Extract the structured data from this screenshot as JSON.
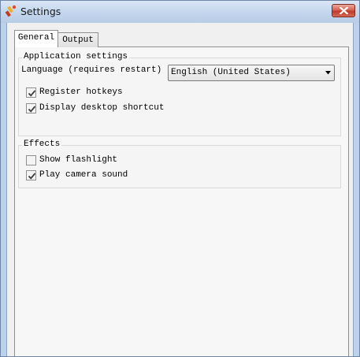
{
  "window": {
    "title": "Settings"
  },
  "tabs": [
    {
      "label": "General",
      "active": true
    },
    {
      "label": "Output",
      "active": false
    }
  ],
  "application_settings": {
    "title": "Application settings",
    "language_label": "Language (requires restart)",
    "language_value": "English (United States)",
    "register_hotkeys": {
      "label": "Register hotkeys",
      "checked": true
    },
    "desktop_shortcut": {
      "label": "Display desktop shortcut",
      "checked": true
    }
  },
  "effects": {
    "title": "Effects",
    "show_flashlight": {
      "label": "Show flashlight",
      "checked": false
    },
    "camera_sound": {
      "label": "Play camera sound",
      "checked": true
    }
  }
}
